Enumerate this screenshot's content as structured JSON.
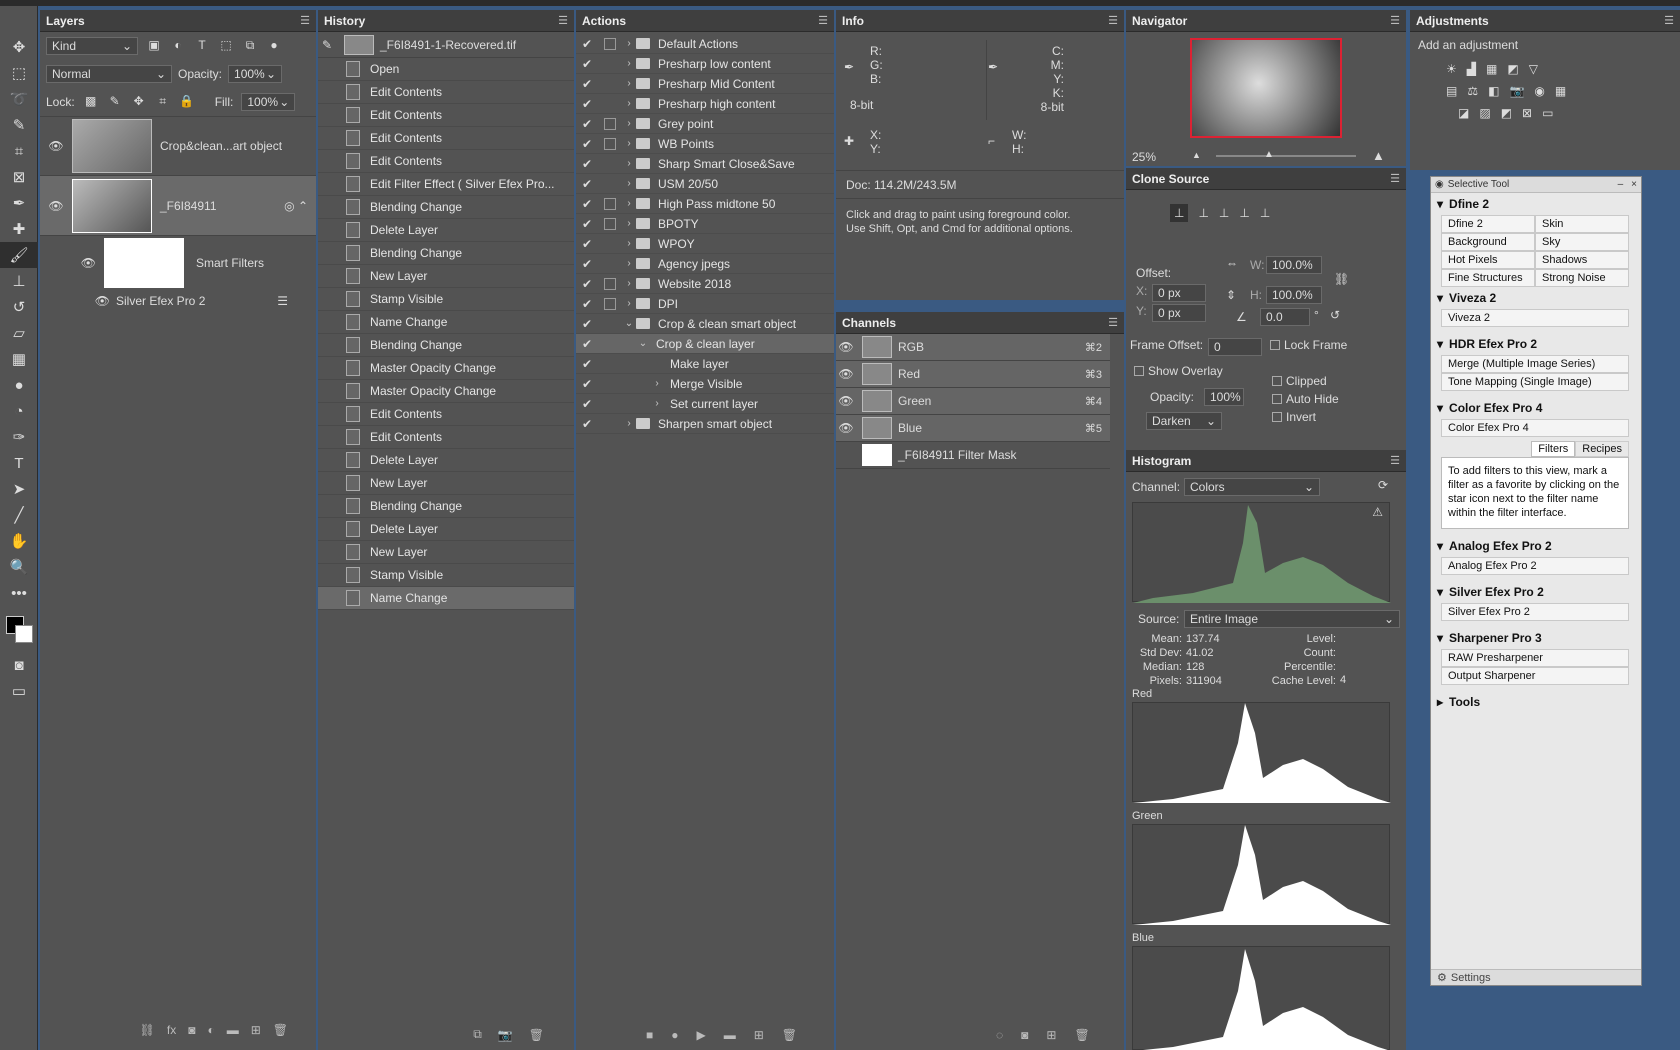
{
  "layers": {
    "title": "Layers",
    "filter": "Kind",
    "blend": "Normal",
    "opacity_label": "Opacity:",
    "opacity": "100%",
    "lock_label": "Lock:",
    "fill_label": "Fill:",
    "fill": "100%",
    "layer1": "Crop&clean...art object",
    "layer2": "_F6I84911",
    "smart_filters": "Smart Filters",
    "silver": "Silver Efex Pro 2"
  },
  "history": {
    "title": "History",
    "snapshot": "_F6I8491-1-Recovered.tif",
    "items": [
      "Open",
      "Edit Contents",
      "Edit Contents",
      "Edit Contents",
      "Edit Contents",
      "Edit Filter Effect ( Silver Efex Pro...",
      "Blending Change",
      "Delete Layer",
      "Blending Change",
      "New Layer",
      "Stamp Visible",
      "Name Change",
      "Blending Change",
      "Master Opacity Change",
      "Master Opacity Change",
      "Edit Contents",
      "Edit Contents",
      "Delete Layer",
      "New Layer",
      "Blending Change",
      "Delete Layer",
      "New Layer",
      "Stamp Visible",
      "Name Change"
    ]
  },
  "actions": {
    "title": "Actions",
    "items": [
      "Default Actions",
      "Presharp low content",
      "Presharp Mid Content",
      "Presharp high content",
      "Grey point",
      "WB Points",
      "Sharp Smart Close&Save",
      "USM 20/50",
      "High Pass midtone 50",
      "BPOTY",
      "WPOY",
      "Agency jpegs",
      "Website 2018",
      "DPI",
      "Crop & clean smart object",
      "Crop & clean layer",
      "Make layer",
      "Merge Visible",
      "Set current layer",
      "Sharpen smart object"
    ]
  },
  "info": {
    "title": "Info",
    "r": "R:",
    "g": "G:",
    "b": "B:",
    "c": "C:",
    "m": "M:",
    "y": "Y:",
    "k": "K:",
    "bit1": "8-bit",
    "bit2": "8-bit",
    "x": "X:",
    "yy": "Y:",
    "w": "W:",
    "h": "H:",
    "doc": "Doc: 114.2M/243.5M",
    "hint1": "Click and drag to paint using foreground color.",
    "hint2": "Use Shift, Opt, and Cmd for additional options."
  },
  "channels": {
    "title": "Channels",
    "items": [
      {
        "name": "RGB",
        "key": "⌘2"
      },
      {
        "name": "Red",
        "key": "⌘3"
      },
      {
        "name": "Green",
        "key": "⌘4"
      },
      {
        "name": "Blue",
        "key": "⌘5"
      }
    ],
    "mask": "_F6I84911 Filter Mask"
  },
  "navigator": {
    "title": "Navigator",
    "zoom": "25%"
  },
  "clone": {
    "title": "Clone Source",
    "offset": "Offset:",
    "w_label": "W:",
    "w": "100.0%",
    "h_label": "H:",
    "h": "100.0%",
    "x_label": "X:",
    "x": "0 px",
    "y_label": "Y:",
    "y": "0 px",
    "angle": "0.0",
    "deg": "°",
    "frame_offset": "Frame Offset:",
    "frame_val": "0",
    "lock_frame": "Lock Frame",
    "show_overlay": "Show Overlay",
    "opacity_label": "Opacity:",
    "opacity": "100%",
    "clipped": "Clipped",
    "auto_hide": "Auto Hide",
    "invert": "Invert",
    "mode": "Darken"
  },
  "histogram": {
    "title": "Histogram",
    "channel_label": "Channel:",
    "channel": "Colors",
    "source_label": "Source:",
    "source": "Entire Image",
    "mean_l": "Mean:",
    "mean": "137.74",
    "std_l": "Std Dev:",
    "std": "41.02",
    "median_l": "Median:",
    "median": "128",
    "pixels_l": "Pixels:",
    "pixels": "311904",
    "level_l": "Level:",
    "count_l": "Count:",
    "pct_l": "Percentile:",
    "cache_l": "Cache Level:",
    "cache": "4",
    "red": "Red",
    "green": "Green",
    "blue": "Blue"
  },
  "adjustments": {
    "title": "Adjustments",
    "add": "Add an adjustment"
  },
  "selective": {
    "title": "Selective Tool",
    "dfine": "Dfine 2",
    "dfine_btns": [
      "Dfine 2",
      "Skin",
      "Background",
      "Sky",
      "Hot Pixels",
      "Shadows",
      "Fine Structures",
      "Strong Noise"
    ],
    "viveza": "Viveza 2",
    "viveza_btn": "Viveza 2",
    "hdr": "HDR Efex Pro 2",
    "hdr_btns": [
      "Merge (Multiple Image Series)",
      "Tone Mapping (Single Image)"
    ],
    "color": "Color Efex Pro 4",
    "color_btn": "Color Efex Pro 4",
    "tab_filters": "Filters",
    "tab_recipes": "Recipes",
    "color_text": "To add filters to this view, mark a filter as a favorite by clicking on the star icon next to the filter name within the filter interface.",
    "analog": "Analog Efex Pro 2",
    "analog_btn": "Analog Efex Pro 2",
    "silver": "Silver Efex Pro 2",
    "silver_btn": "Silver Efex Pro 2",
    "sharp": "Sharpener Pro 3",
    "sharp_btns": [
      "RAW Presharpener",
      "Output Sharpener"
    ],
    "tools": "Tools",
    "settings": "Settings"
  }
}
